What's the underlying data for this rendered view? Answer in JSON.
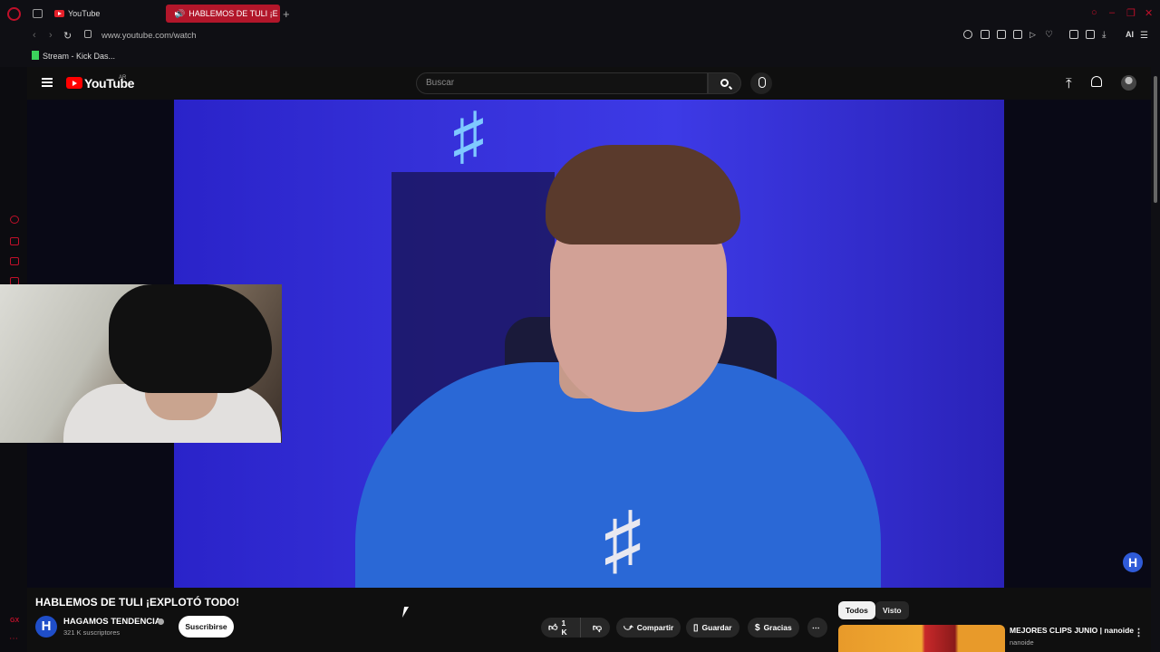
{
  "browser": {
    "tabs": [
      {
        "label": "YouTube",
        "active": false
      },
      {
        "label": "HABLEMOS DE TULI ¡E",
        "active": true
      }
    ],
    "new_tab_label": "+",
    "url": "www.youtube.com/watch",
    "bookmarks": [
      {
        "label": "Stream - Kick Das..."
      }
    ],
    "toolbar_ai_label": "AI",
    "accent_color": "#c0102a"
  },
  "youtube": {
    "logo_text": "YouTube",
    "region": "AR",
    "search": {
      "placeholder": "Buscar",
      "value": ""
    }
  },
  "video": {
    "title": "HABLEMOS DE TULI ¡EXPLOTÓ TODO!",
    "channel": {
      "name": "HAGAMOS TENDENCIA",
      "avatar_letter": "H",
      "subscribers": "321 K suscriptores",
      "subscribe_label": "Suscribirse"
    },
    "actions": {
      "likes": "1 K",
      "share": "Compartir",
      "save": "Guardar",
      "thanks": "Gracias",
      "more": "⋯"
    },
    "watermark": "H"
  },
  "sidebar": {
    "chips": [
      {
        "label": "Todos",
        "active": true
      },
      {
        "label": "Visto",
        "active": false
      }
    ],
    "recommendation": {
      "title": "MEJORES CLIPS JUNIO | nanoide",
      "channel": "nanoide",
      "more": "⋮"
    }
  }
}
